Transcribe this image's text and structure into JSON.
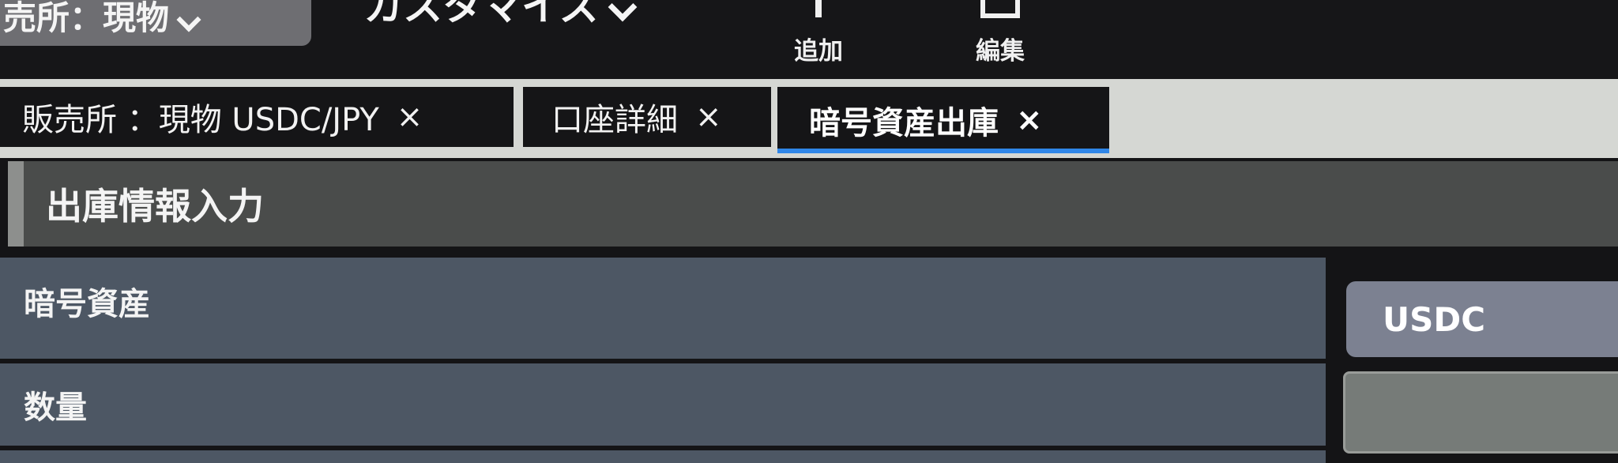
{
  "toolbar": {
    "market_selector": {
      "label": "売所：現物",
      "icon": "chevron-down-icon"
    },
    "customize": {
      "label": "カスタマイズ",
      "icon": "chevron-down-icon"
    },
    "add_button": {
      "label": "追加",
      "icon": "plus-icon"
    },
    "edit_button": {
      "label": "編集",
      "icon": "edit-icon"
    }
  },
  "tabs": [
    {
      "label": "販売所 ：現物 USDC/JPY",
      "close": "×",
      "active": false
    },
    {
      "label": "口座詳細",
      "close": "×",
      "active": false
    },
    {
      "label": "暗号資産出庫",
      "close": "×",
      "active": true
    }
  ],
  "colors": {
    "active_tab_underline": "#2f86e8",
    "row_label_bg": "#4d5764",
    "select_bg": "#7c8191"
  },
  "section": {
    "title": "出庫情報入力"
  },
  "form": {
    "asset": {
      "label": "暗号資産",
      "value": "USDC"
    },
    "quantity": {
      "label": "数量",
      "value": "",
      "placeholder": ""
    }
  }
}
